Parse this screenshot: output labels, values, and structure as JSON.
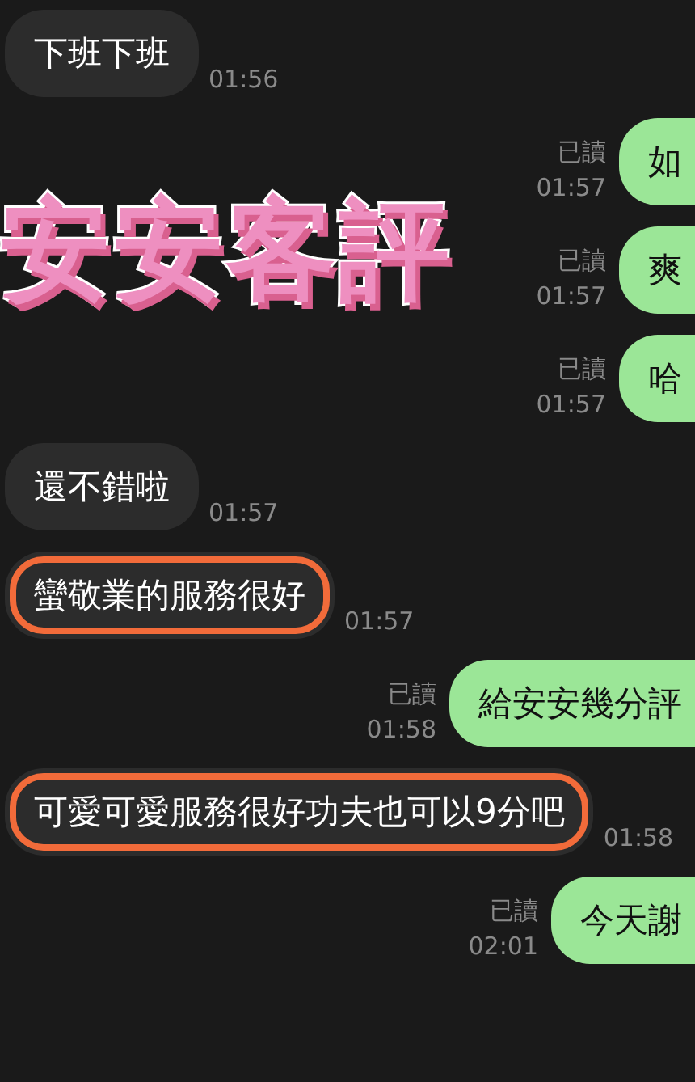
{
  "overlay_title": "安安客評",
  "messages": [
    {
      "kind": "incoming",
      "text": "下班下班",
      "time": "01:56",
      "highlighted": false
    },
    {
      "kind": "outgoing",
      "text": "如",
      "read_label": "已讀",
      "time": "01:57"
    },
    {
      "kind": "outgoing",
      "text": "爽",
      "read_label": "已讀",
      "time": "01:57"
    },
    {
      "kind": "outgoing",
      "text": "哈",
      "read_label": "已讀",
      "time": "01:57"
    },
    {
      "kind": "incoming",
      "text": "還不錯啦",
      "time": "01:57",
      "highlighted": false
    },
    {
      "kind": "incoming",
      "text": "蠻敬業的服務很好",
      "time": "01:57",
      "highlighted": true
    },
    {
      "kind": "outgoing",
      "text": "給安安幾分評",
      "read_label": "已讀",
      "time": "01:58"
    },
    {
      "kind": "incoming",
      "text": "可愛可愛服務很好功夫也可以9分吧",
      "time": "01:58",
      "highlighted": true
    },
    {
      "kind": "outgoing",
      "text": "今天謝",
      "read_label": "已讀",
      "time": "02:01"
    }
  ]
}
